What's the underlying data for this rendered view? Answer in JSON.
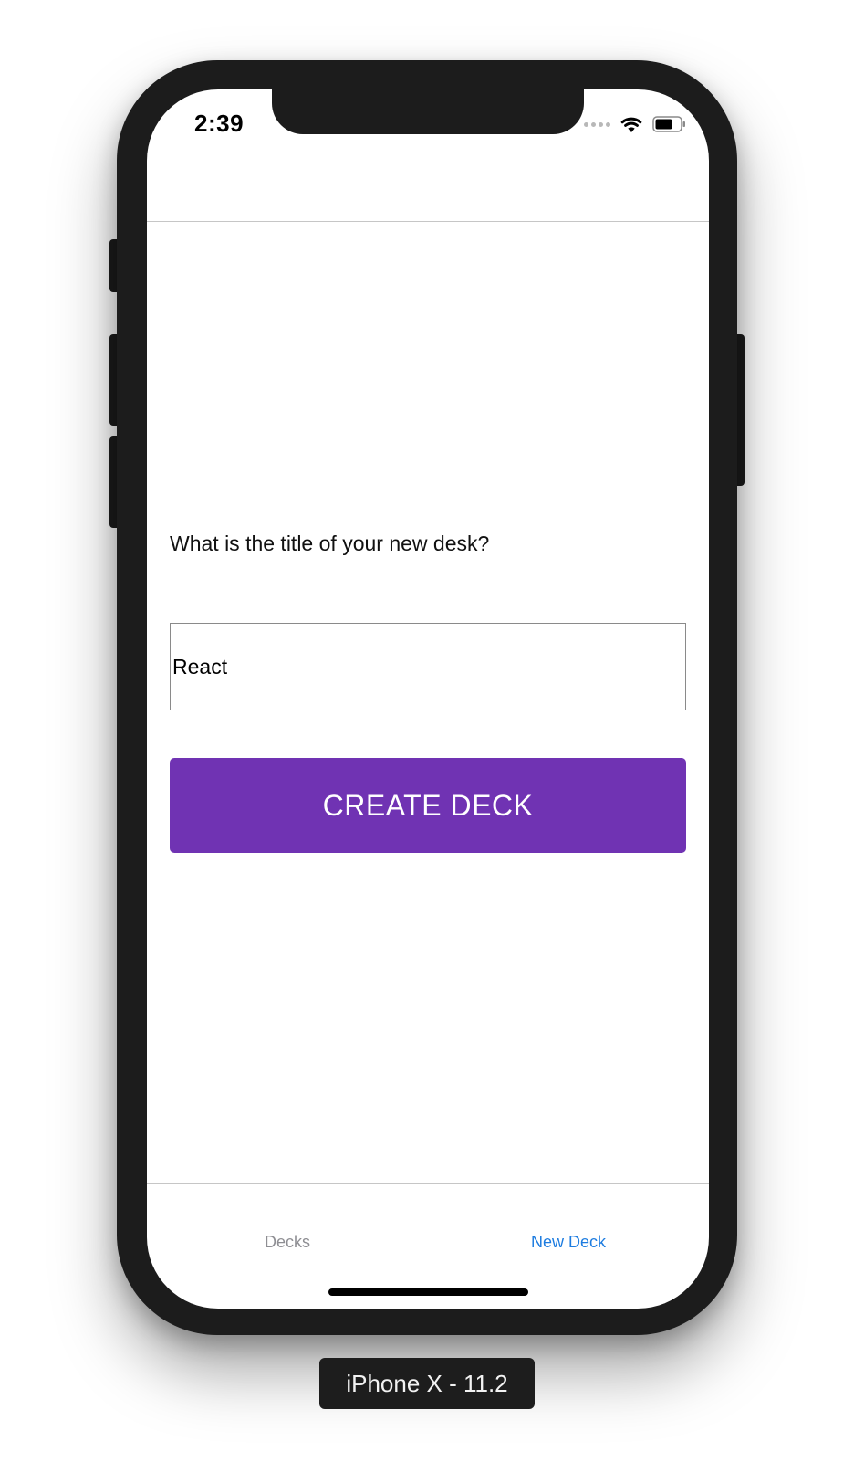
{
  "status_bar": {
    "time": "2:39",
    "icons": [
      "signal-dots-icon",
      "wifi-icon",
      "battery-icon"
    ]
  },
  "form": {
    "question": "What is the title of your new desk?",
    "input_value": "React",
    "button_label": "CREATE DECK",
    "button_color": "#7033b3"
  },
  "tab_bar": {
    "tabs": [
      {
        "label": "Decks",
        "active": false
      },
      {
        "label": "New Deck",
        "active": true
      }
    ],
    "active_color": "#1d7ce0",
    "inactive_color": "#8e8e93"
  },
  "simulator": {
    "device_label": "iPhone X - 11.2"
  }
}
